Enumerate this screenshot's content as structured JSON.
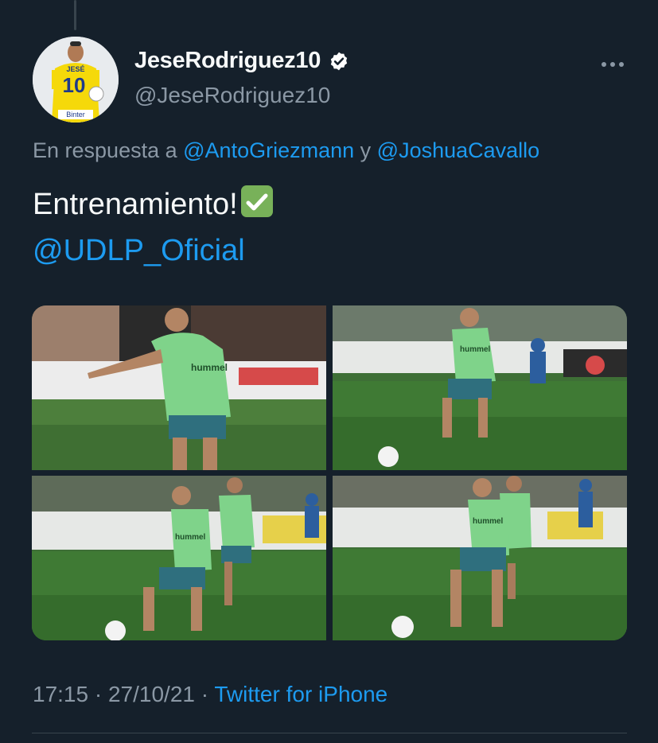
{
  "tweet": {
    "display_name": "JeseRodriguez10",
    "handle": "@JeseRodriguez10",
    "verified": true,
    "reply_prefix": "En respuesta a",
    "reply_users": [
      "@AntoGriezmann",
      "@JoshuaCavallo"
    ],
    "reply_joiner": "y",
    "text_line1": "Entrenamiento!",
    "text_emoji": "check-mark-button-emoji",
    "text_line2": "@UDLP_Oficial",
    "time": "17:15",
    "date": "27/10/21",
    "separator": "·",
    "source": "Twitter for iPhone"
  },
  "avatar": {
    "jersey_number": "10",
    "jersey_name": "JESÉ",
    "sponsor": "Binter"
  },
  "photos": [
    {
      "name": "photo-1",
      "jersey": "hummel"
    },
    {
      "name": "photo-2",
      "jersey": "hummel"
    },
    {
      "name": "photo-3",
      "jersey": "hummel"
    },
    {
      "name": "photo-4",
      "jersey": "hummel"
    }
  ],
  "colors": {
    "background": "#15202b",
    "link": "#1d9bf0",
    "secondary_text": "#8b98a5",
    "verified_badge": "#ffffff",
    "pitch_green": "#3e6f36",
    "bib_green": "#7fd38a"
  }
}
